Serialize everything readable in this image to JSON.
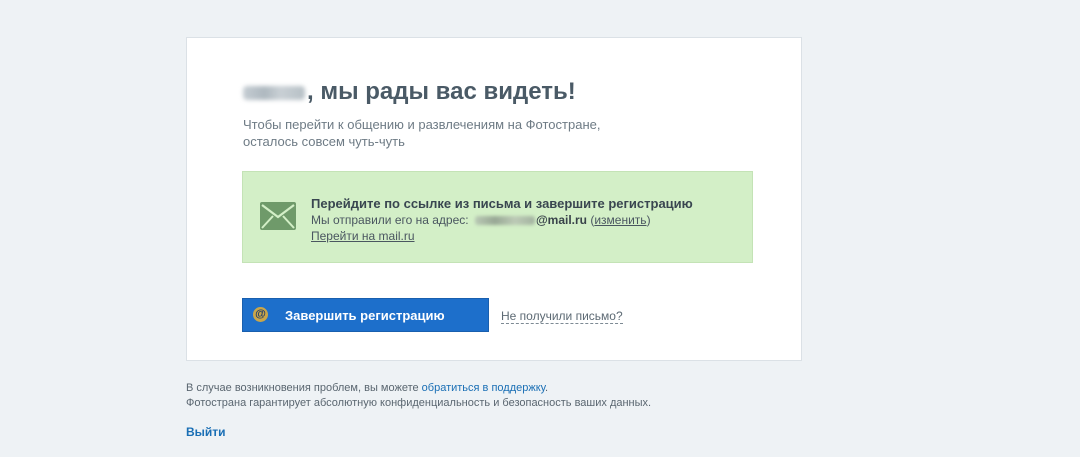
{
  "card": {
    "greeting_suffix": ", мы рады вас видеть!",
    "subtitle_line1": "Чтобы перейти к общению и развлечениям на Фотостране,",
    "subtitle_line2": "осталось совсем чуть-чуть"
  },
  "notice": {
    "icon": "envelope-icon",
    "title": "Перейдите по ссылке из письма и завершите регистрацию",
    "sent_prefix": "Мы отправили его на адрес: ",
    "email_domain": "@mail.ru",
    "change_open": " (",
    "change_label": "изменить",
    "change_close": ")",
    "goto_link": "Перейти на mail.ru"
  },
  "actions": {
    "complete_label": "Завершить регистрацию",
    "complete_icon": "@",
    "no_letter_label": "Не получили письмо?"
  },
  "footer": {
    "problem_prefix": "В случае возникновения проблем, вы можете ",
    "support_link": "обратиться в поддержку",
    "problem_suffix": ".",
    "privacy": "Фотострана гарантирует абсолютную конфиденциальность и безопасность ваших данных.",
    "logout": "Выйти"
  },
  "colors": {
    "page_bg": "#eef2f5",
    "notice_bg": "#d3efc7",
    "button_bg": "#1d6fcb",
    "link": "#1a6fb5"
  }
}
